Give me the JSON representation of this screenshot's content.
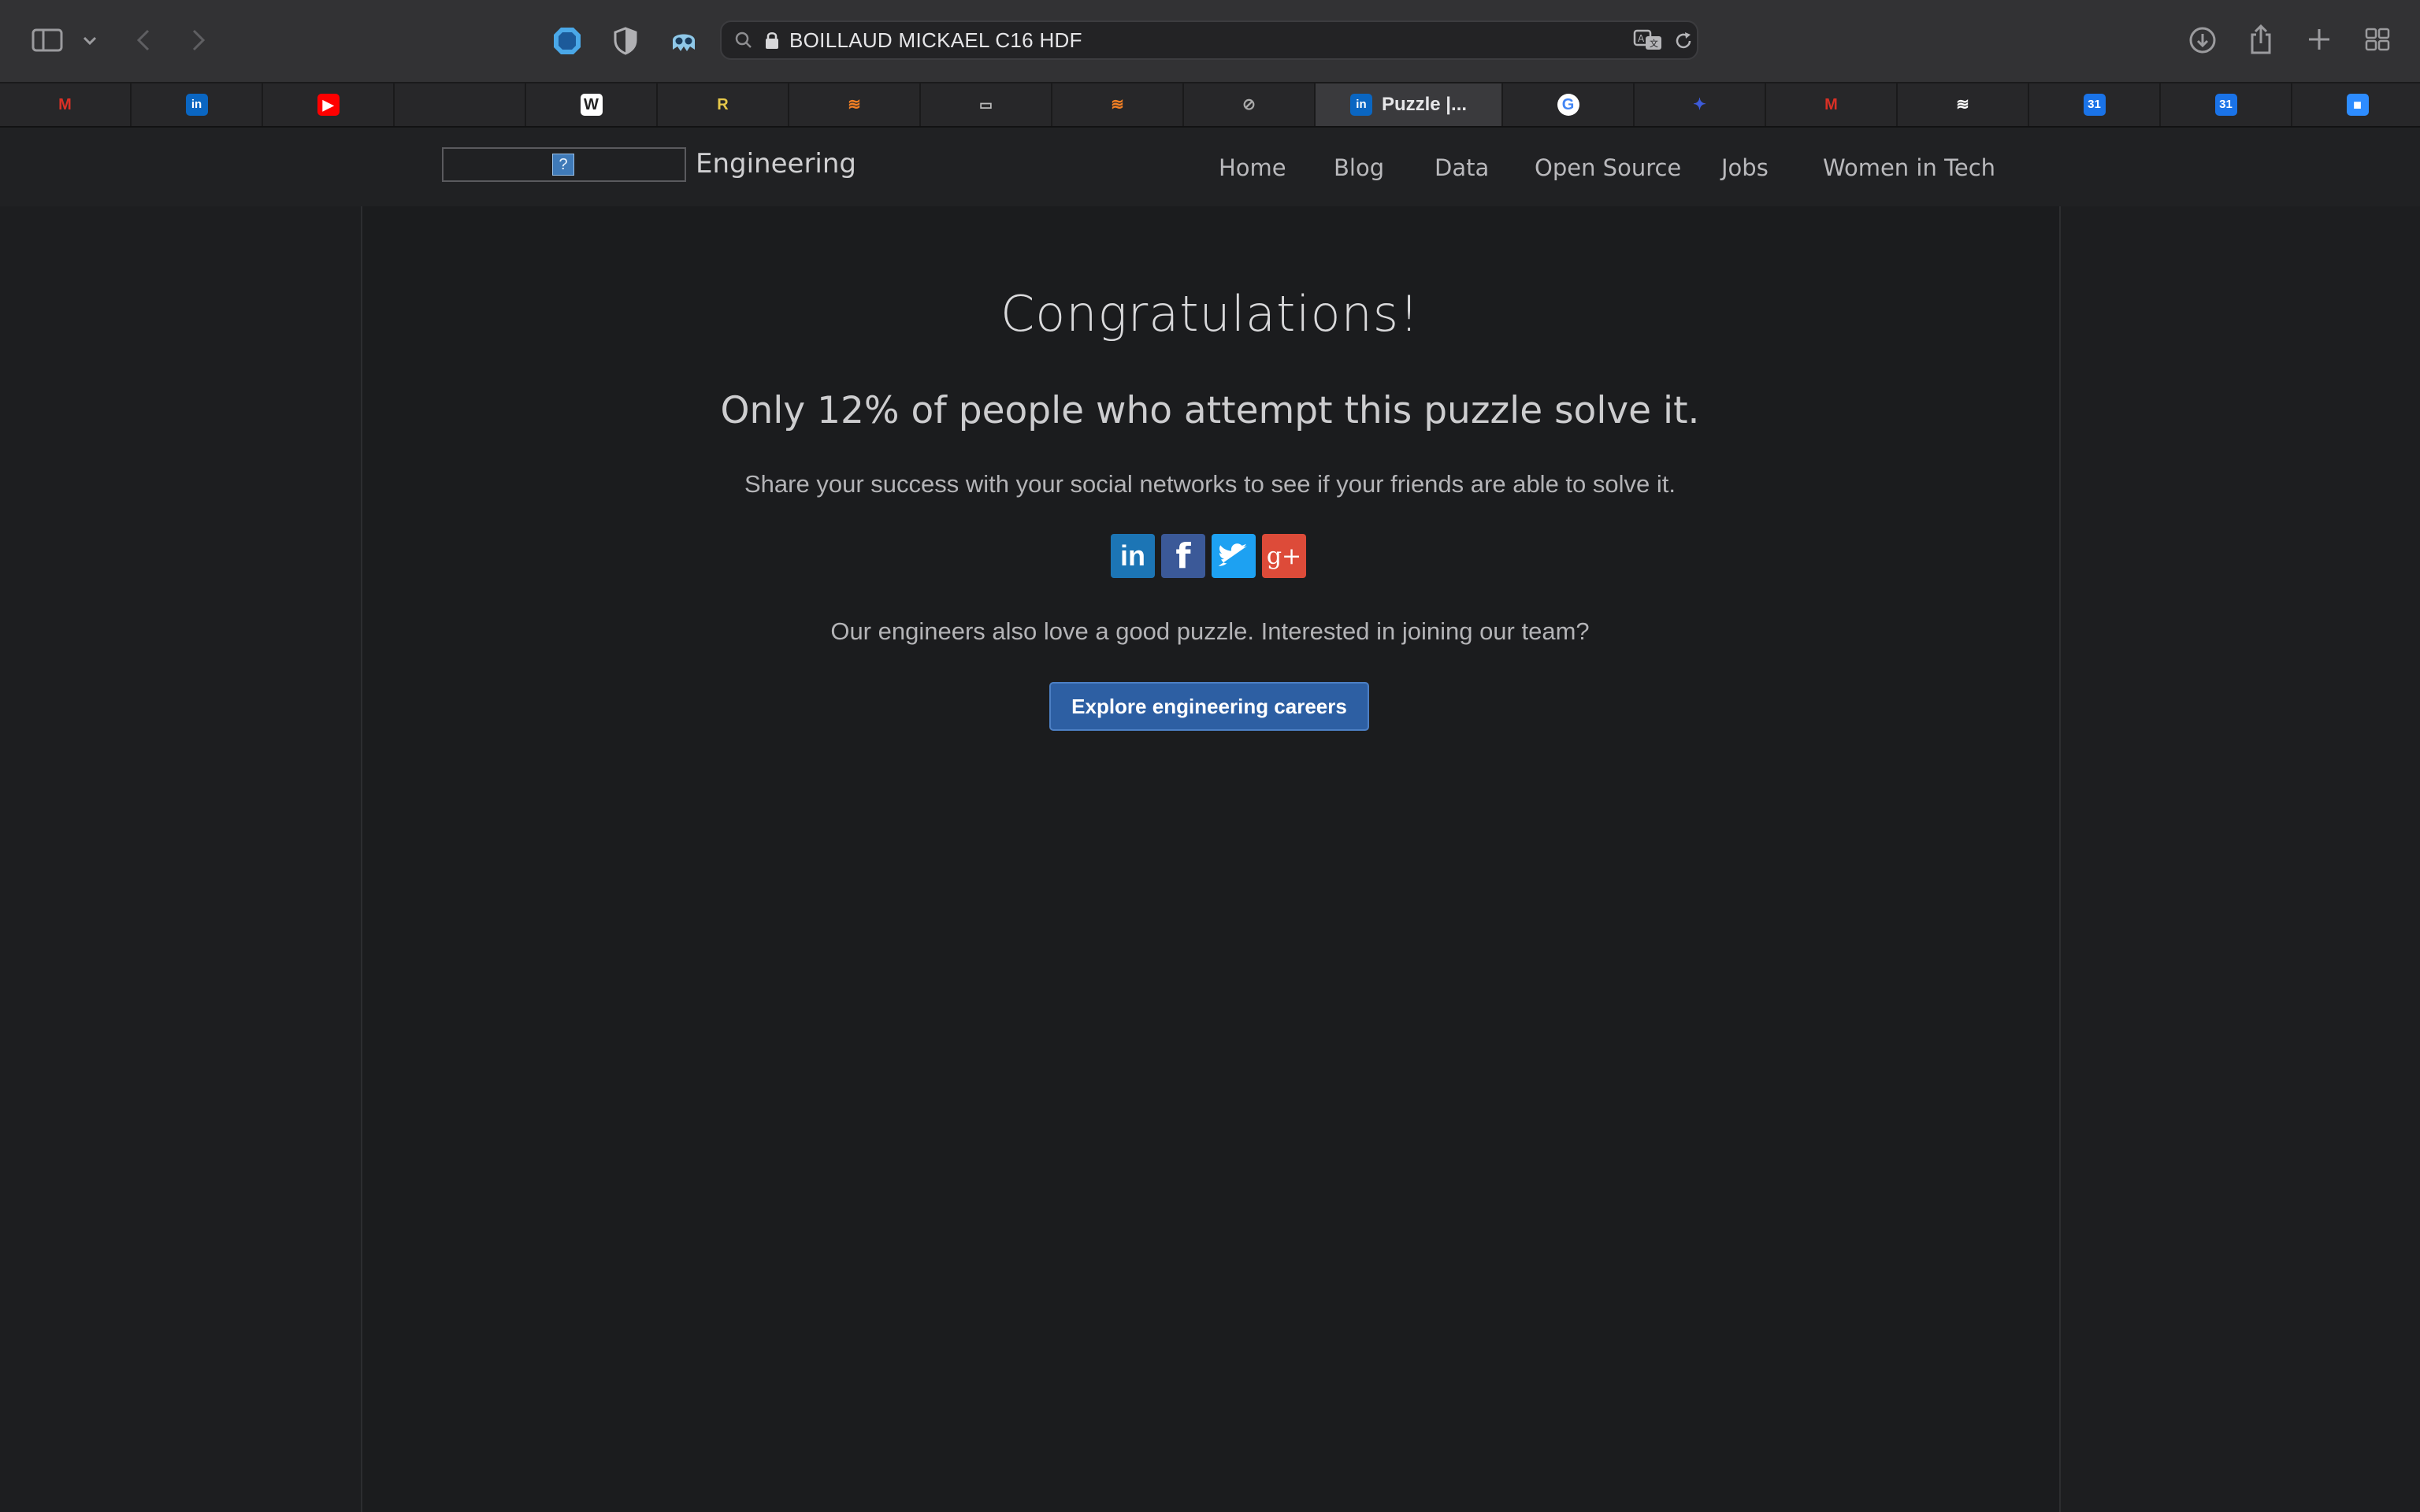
{
  "browser": {
    "address_bar": {
      "url_text": "BOILLAUD MICKAEL C16 HDF"
    },
    "icons": [
      "sidebar-icon",
      "chevron-down-icon",
      "back-icon",
      "forward-icon",
      "shield-extension-icon",
      "privacy-shield-icon",
      "ghost-extension-icon",
      "search-icon",
      "lock-icon",
      "translate-icon",
      "reload-icon",
      "download-icon",
      "share-icon",
      "new-tab-icon",
      "tab-overview-icon"
    ],
    "tabs": [
      {
        "icon": "gmail-icon",
        "glyph": "M",
        "color": "#d93025"
      },
      {
        "icon": "linkedin-icon",
        "glyph": "in",
        "color": "#0a66c2"
      },
      {
        "icon": "youtube-icon",
        "glyph": "▶",
        "color": "#ff0000"
      },
      {
        "icon": "blank-site-icon",
        "glyph": "",
        "color": "#2e2e30"
      },
      {
        "icon": "wikipedia-icon",
        "glyph": "W",
        "color": "#ffffff"
      },
      {
        "icon": "r-site-icon",
        "glyph": "R",
        "color": "#e6c84a"
      },
      {
        "icon": "stackoverflow-icon",
        "glyph": "≋",
        "color": "#f48024"
      },
      {
        "icon": "card-site-icon",
        "glyph": "▭",
        "color": "#bbbbbb"
      },
      {
        "icon": "stackoverflow-icon",
        "glyph": "≋",
        "color": "#f48024"
      },
      {
        "icon": "compass-icon",
        "glyph": "⊘",
        "color": "#aaaaaa"
      },
      {
        "icon": "linkedin-icon",
        "glyph": "in",
        "color": "#0a66c2",
        "title": "Puzzle |..."
      },
      {
        "icon": "google-icon",
        "glyph": "G",
        "color": "#4285f4"
      },
      {
        "icon": "puzzle-site-icon",
        "glyph": "✦",
        "color": "#3d5bd9"
      },
      {
        "icon": "gmail-icon",
        "glyph": "M",
        "color": "#d93025"
      },
      {
        "icon": "steem-icon",
        "glyph": "≋",
        "color": "#ffffff"
      },
      {
        "icon": "calendar-icon",
        "glyph": "31",
        "color": "#1a73e8"
      },
      {
        "icon": "calendar-icon",
        "glyph": "31",
        "color": "#1a73e8"
      },
      {
        "icon": "zoom-icon",
        "glyph": "■",
        "color": "#2d8cff"
      }
    ]
  },
  "site": {
    "logo_placeholder": "?",
    "brand": "Engineering",
    "nav": [
      "Home",
      "Blog",
      "Data",
      "Open Source",
      "Jobs",
      "Women in Tech"
    ]
  },
  "main": {
    "heading": "Congratulations!",
    "subheading": "Only 12% of people who attempt this puzzle solve it.",
    "share_text": "Share your success with your social networks to see if your friends are able to solve it.",
    "social": [
      {
        "name": "linkedin",
        "glyph": "in",
        "color": "#1c75b5"
      },
      {
        "name": "facebook",
        "glyph": "f",
        "color": "#3b5998"
      },
      {
        "name": "twitter",
        "glyph": "t",
        "color": "#1da1f2"
      },
      {
        "name": "google-plus",
        "glyph": "g+",
        "color": "#dd4b39"
      }
    ],
    "careers_text": "Our engineers also love a good puzzle. Interested in joining our team?",
    "careers_button": "Explore engineering careers"
  }
}
